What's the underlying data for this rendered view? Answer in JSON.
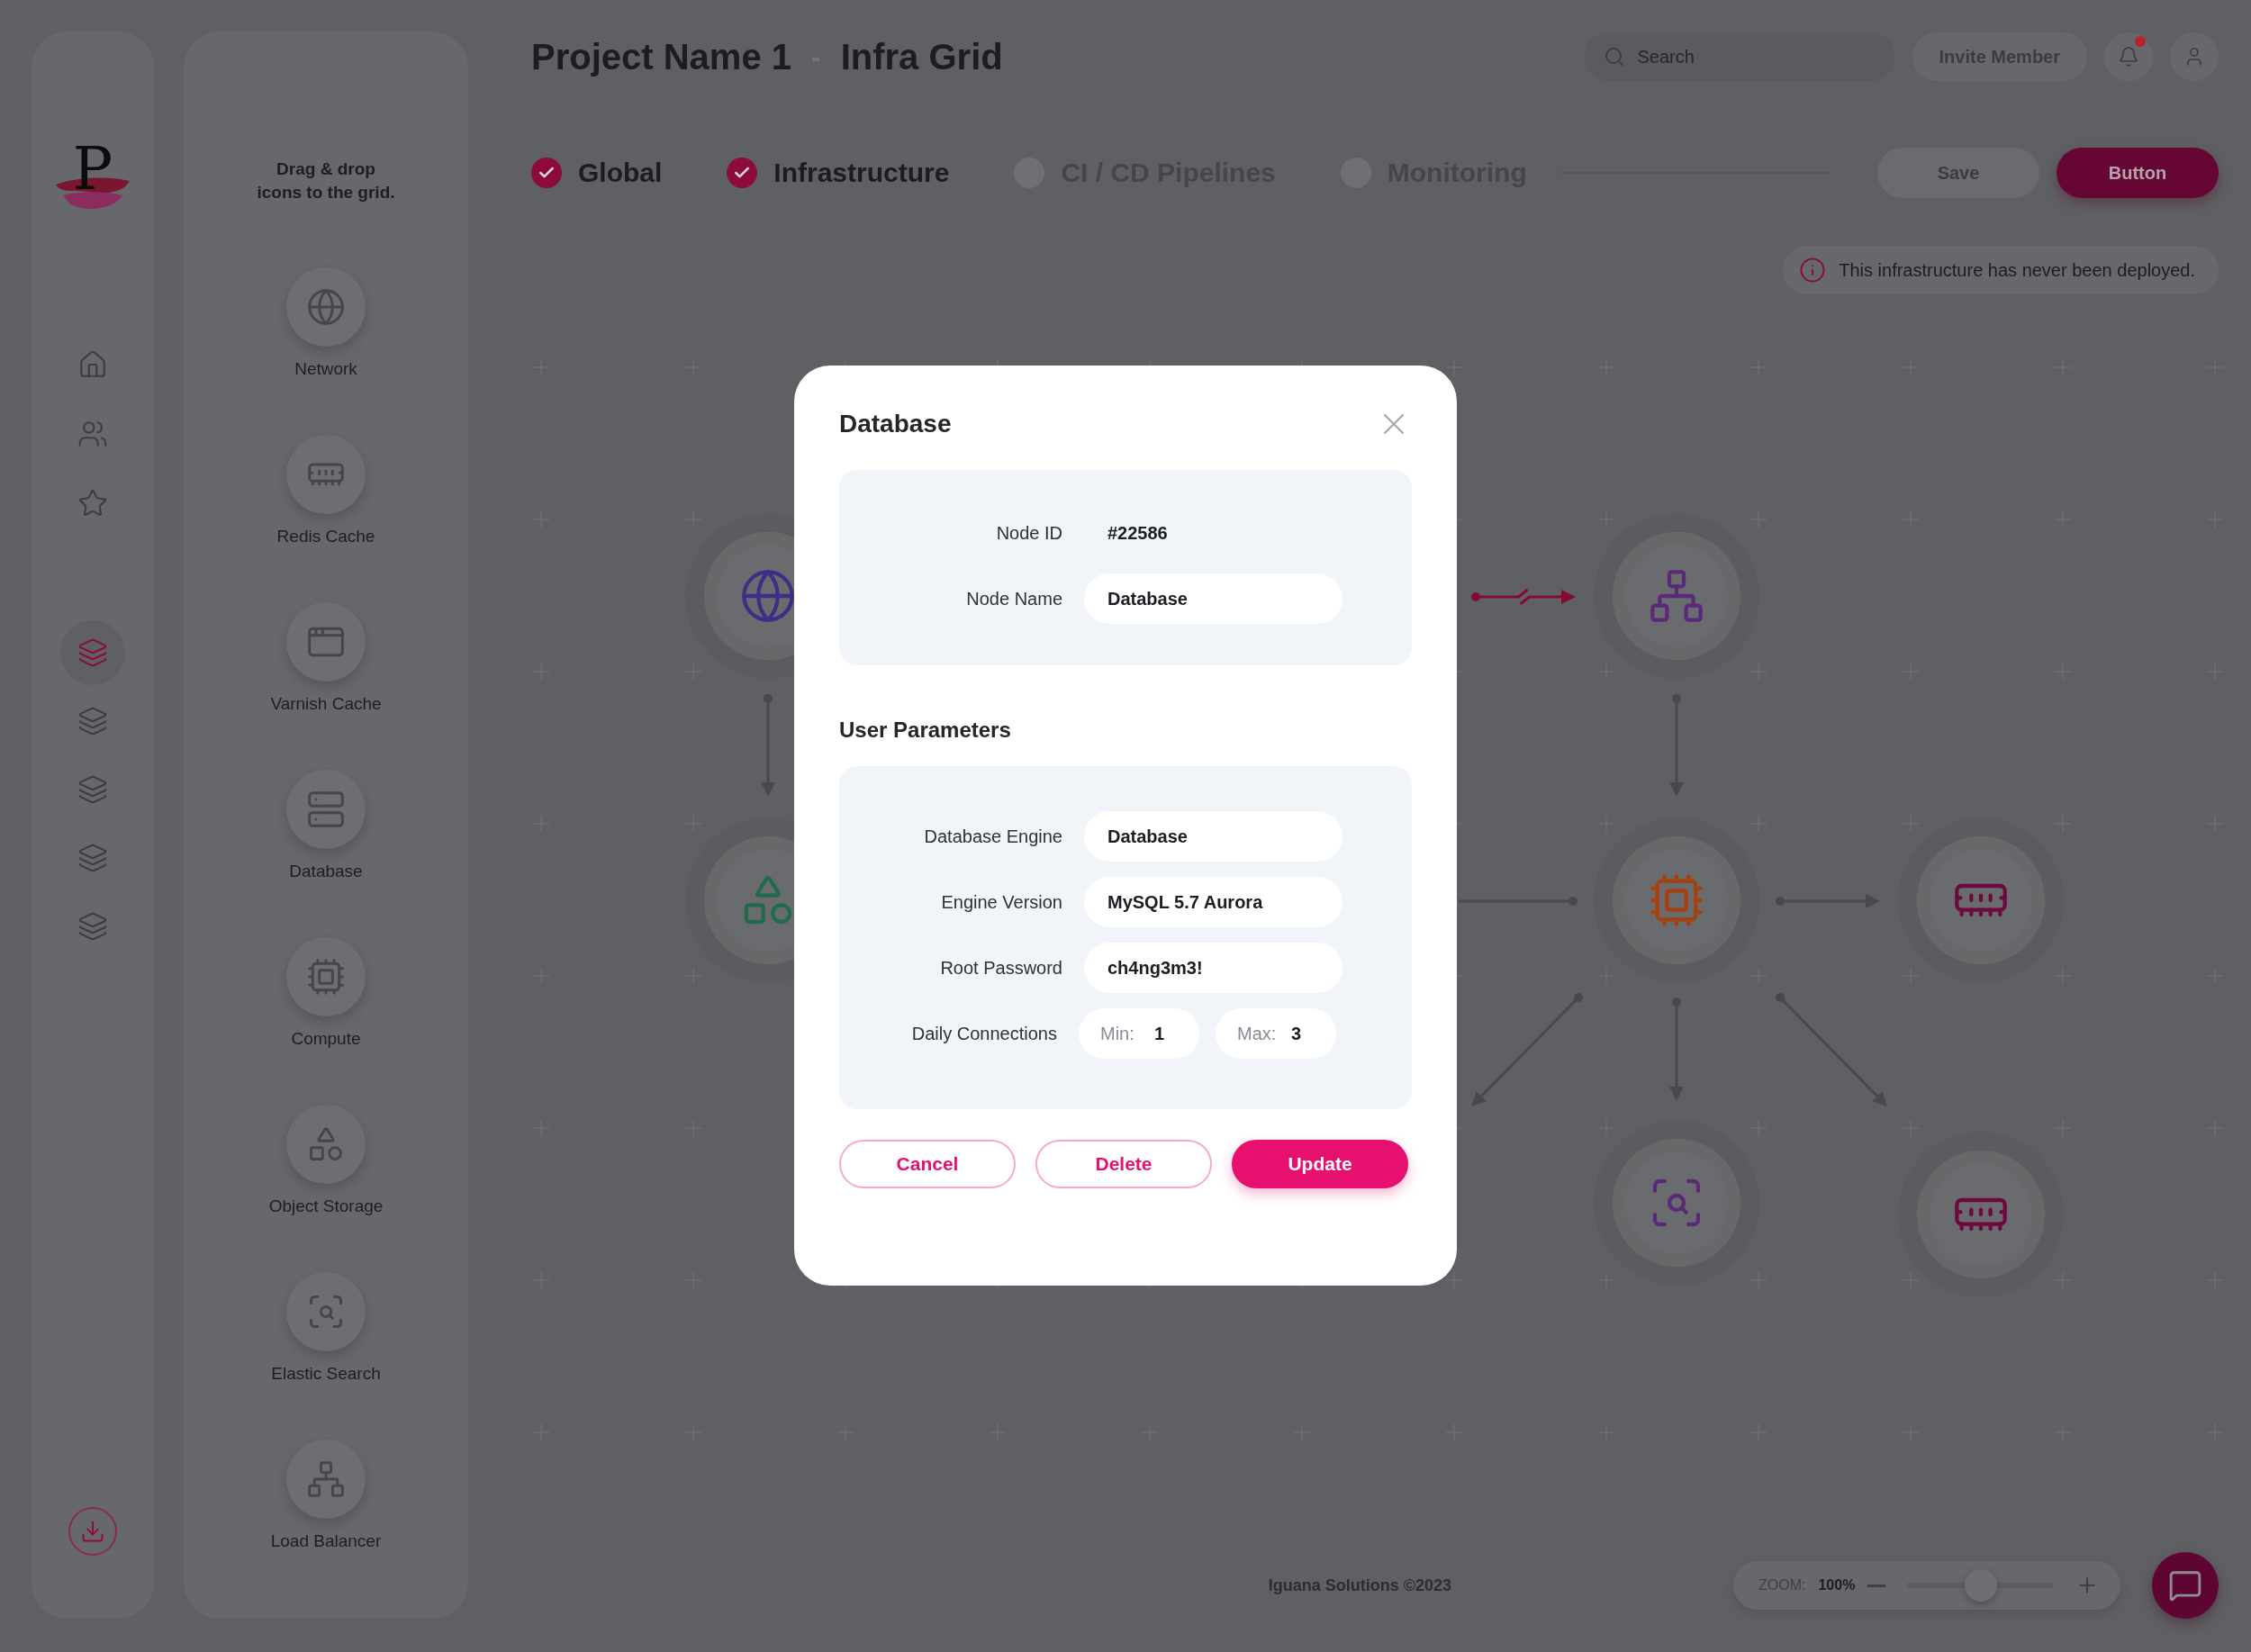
{
  "logo": {
    "letter": "P"
  },
  "rail": {
    "items": [
      {
        "kind": "home",
        "selected": false
      },
      {
        "kind": "users",
        "selected": false
      },
      {
        "kind": "star",
        "selected": false
      },
      {
        "kind": "layers",
        "selected": true
      },
      {
        "kind": "layers",
        "selected": false
      },
      {
        "kind": "layers",
        "selected": false
      },
      {
        "kind": "layers",
        "selected": false
      },
      {
        "kind": "layers",
        "selected": false
      }
    ],
    "download": {
      "kind": "download"
    }
  },
  "palette": {
    "hint": "Drag & drop\nicons to the grid.",
    "items": [
      {
        "kind": "network",
        "label": "Network"
      },
      {
        "kind": "redis",
        "label": "Redis Cache"
      },
      {
        "kind": "varnish",
        "label": "Varnish Cache"
      },
      {
        "kind": "database",
        "label": "Database"
      },
      {
        "kind": "compute",
        "label": "Compute"
      },
      {
        "kind": "storage",
        "label": "Object Storage"
      },
      {
        "kind": "search",
        "label": "Elastic Search"
      },
      {
        "kind": "balancer",
        "label": "Load Balancer"
      }
    ]
  },
  "header": {
    "title": "Project Name 1",
    "separator": "-",
    "subtitle": "Infra Grid",
    "search": {
      "placeholder": "Search"
    },
    "invite": "Invite Member",
    "notifications": {
      "unread": true
    }
  },
  "steps": [
    {
      "label": "Global",
      "completed": true
    },
    {
      "label": "Infrastructure",
      "completed": true
    },
    {
      "label": "CI / CD Pipelines",
      "completed": false
    },
    {
      "label": "Monitoring",
      "completed": false
    }
  ],
  "actions": [
    {
      "label": "Save",
      "kind": "secondary"
    },
    {
      "label": "Button",
      "kind": "primary"
    }
  ],
  "notice": {
    "text": "This infrastructure has never been deployed."
  },
  "canvas": {
    "nodes": [
      {
        "kind": "network",
        "color": "#3b2f86"
      },
      {
        "kind": "storage",
        "color": "#1f6b4c"
      },
      {
        "kind": "balancer",
        "color": "#5a2a78"
      },
      {
        "kind": "compute",
        "color": "#a3420f"
      },
      {
        "kind": "redis",
        "color": "#6d0a3c"
      },
      {
        "kind": "search",
        "color": "#5a2a78"
      },
      {
        "kind": "redis",
        "color": "#6d0a3c"
      }
    ],
    "edges": [
      {
        "kind": "arrow"
      },
      {
        "kind": "broken"
      },
      {
        "kind": "arrow"
      },
      {
        "kind": "link"
      },
      {
        "kind": "arrow"
      },
      {
        "kind": "arrow"
      },
      {
        "kind": "arrow"
      },
      {
        "kind": "arrow"
      }
    ]
  },
  "modal": {
    "title": "Database",
    "fields": [
      {
        "kind": "static",
        "label": "Node ID",
        "value": "#22586"
      },
      {
        "kind": "text",
        "label": "Node Name",
        "value": "Database"
      }
    ],
    "section": "User Parameters",
    "params": [
      {
        "kind": "text",
        "label": "Database Engine",
        "value": "Database"
      },
      {
        "kind": "text",
        "label": "Engine Version",
        "value": "MySQL 5.7 Aurora"
      },
      {
        "kind": "text",
        "label": "Root Password",
        "value": "ch4ng3m3!"
      },
      {
        "kind": "range",
        "label": "Daily Connections",
        "min_label": "Min:",
        "min": "1",
        "max_label": "Max:",
        "max": "3"
      }
    ],
    "buttons": [
      {
        "label": "Cancel",
        "kind": "outline"
      },
      {
        "label": "Delete",
        "kind": "outline"
      },
      {
        "label": "Update",
        "kind": "primary"
      }
    ]
  },
  "footer": {
    "text": "Iguana Solutions ©2023"
  },
  "zoom": {
    "label": "ZOOM:",
    "value": "100%",
    "level": 0.5
  }
}
